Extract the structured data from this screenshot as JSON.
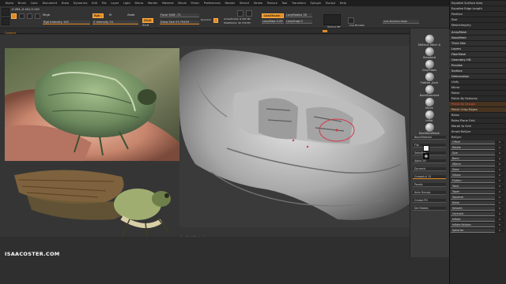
{
  "menubar": {
    "items": [
      "Alpha",
      "Brush",
      "Color",
      "Document",
      "Draw",
      "Dynamics",
      "Edit",
      "File",
      "Layer",
      "Light",
      "Macro",
      "Marker",
      "Material",
      "Movie",
      "Picker",
      "Preferences",
      "Render",
      "Stencil",
      "Stroke",
      "Texture",
      "Tool",
      "Transform",
      "Zplugin",
      "Zscript",
      "Help"
    ]
  },
  "toolbar": {
    "coords": "-0.494,-0.401,0.130",
    "mrgb": "Mrgb",
    "rgb": "Rgb",
    "m": "M",
    "zadd": "Zadd",
    "zsub": "Zsub",
    "zcut": "Zcut",
    "rgb_intensity": "Rgb Intensity 100",
    "z_intensity": "Z Intensity 24",
    "focal_shift": "Focal Shift -71",
    "draw_size": "Draw Size 53.79429",
    "dynamic": "Dynamic",
    "active_points": "ActivePoints: 6.302 Mil",
    "total_points": "TotalPoints: 42.734 Mil",
    "lazy_mouse": "LazyMouse",
    "lazy_radius": "LazyRadius 30",
    "lazy_step": "LazyStep 0.09",
    "lazy_snap": "LazySnap 0",
    "texture_off": "Texture Off",
    "live_boolean": "Live Boolean",
    "backface": "Auto Backface Mask"
  },
  "canvas": {
    "camera_label": "Camera",
    "spotlight_label": "Spotlight Projection",
    "credit": "ISAACOSTER.COM"
  },
  "palette": {
    "brushes": [
      "MAHcut Mech A",
      "Standard",
      "ClayTubes",
      "Flatten_Arch",
      "DamStandard",
      "Move",
      "Inflat",
      "BackfaceMask"
    ],
    "rows": [
      {
        "label": "BasicMaterial",
        "accent": false
      },
      {
        "label": "Flip",
        "accent": false
      },
      {
        "label": "Selection",
        "accent": false
      },
      {
        "label": "Alpha 28",
        "accent": false
      },
      {
        "label": "Dynamic",
        "accent": false
      },
      {
        "label": "CreaseLvl 15",
        "accent": true
      },
      {
        "label": "Panels",
        "accent": false
      },
      {
        "label": "Auto Groups",
        "accent": false
      },
      {
        "label": "Crease PG",
        "accent": false
      },
      {
        "label": "Del Hidden",
        "accent": false
      }
    ]
  },
  "right_panel": {
    "top_items": [
      "Equalize Surface Area",
      "Equalize Edge Length",
      "Position",
      "Size",
      "MeshIntegrity"
    ],
    "header_items": [
      "ArrayMesh",
      "NanoMesh",
      "Thick Skin",
      "Layers",
      "FiberMesh",
      "Geometry HD",
      "Preview",
      "Surface",
      "Deformation"
    ],
    "deform_buttons": [
      "Unify",
      "Mirror",
      "Polish",
      "Polish By Features",
      "Polish By Groups",
      "Polish Crisp Edges",
      "Relax",
      "Relax Plane Grid",
      "Morph to Grid",
      "Smart ReSym",
      "ReSym"
    ],
    "sliders": [
      {
        "label": "Offset",
        "value": "0"
      },
      {
        "label": "Rotate",
        "value": "0"
      },
      {
        "label": "Size",
        "value": "0"
      },
      {
        "label": "Bend",
        "value": "0"
      },
      {
        "label": "SBend",
        "value": "0"
      },
      {
        "label": "Skew",
        "value": "0"
      },
      {
        "label": "SSkew",
        "value": "0"
      },
      {
        "label": "Flatten",
        "value": "0"
      },
      {
        "label": "Twist",
        "value": "0"
      },
      {
        "label": "Taper",
        "value": "0"
      },
      {
        "label": "Squeeze",
        "value": "0"
      },
      {
        "label": "Noise",
        "value": "0"
      },
      {
        "label": "Smooth",
        "value": "0"
      },
      {
        "label": "Contrast",
        "value": "0"
      },
      {
        "label": "Inflate",
        "value": "0"
      },
      {
        "label": "Inflate Balloon",
        "value": "0"
      },
      {
        "label": "Spherize",
        "value": "0"
      }
    ],
    "extra": [
      "Gravity"
    ]
  },
  "colors": {
    "accent": "#e08a23",
    "panel": "#2a2a2a",
    "canvas": "#353535"
  }
}
